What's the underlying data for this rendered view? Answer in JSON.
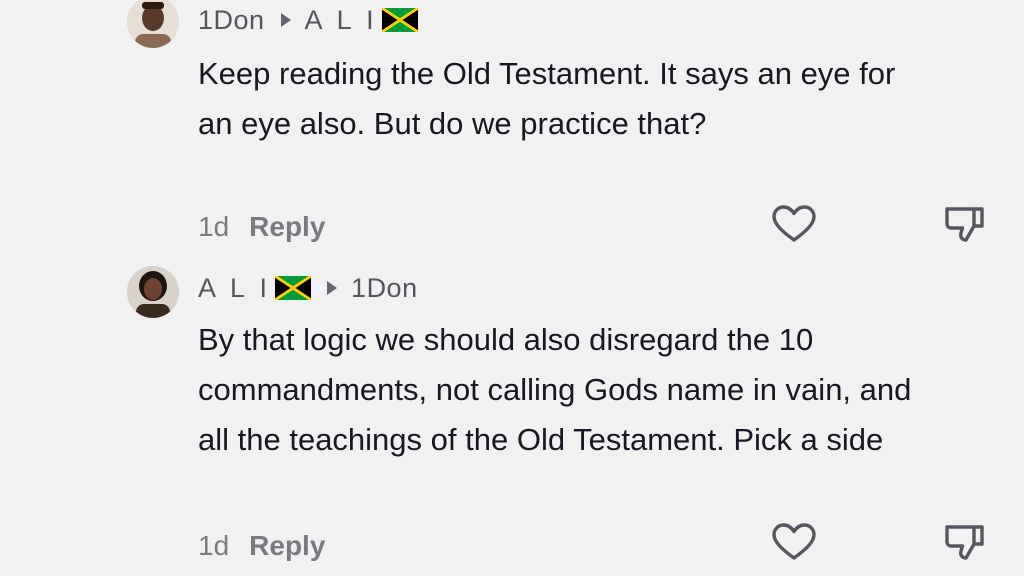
{
  "comments": [
    {
      "avatar_icon": "user-avatar-man",
      "username": "1Don",
      "reply_to": "A L I",
      "reply_to_flag": "jamaica-flag-icon",
      "text": "Keep reading the Old Testament. It says an eye for an eye also. But do we practice that?",
      "time": "1d",
      "reply_label": "Reply"
    },
    {
      "avatar_icon": "user-avatar-woman",
      "username": "A L I",
      "username_flag": "jamaica-flag-icon",
      "reply_to": "1Don",
      "text": "By that logic we should also disregard the 10 commandments, not calling Gods name in vain, and all the teachings of the Old Testament. Pick a side",
      "time": "1d",
      "reply_label": "Reply"
    }
  ],
  "colors": {
    "background": "#f1f1f1",
    "text_primary": "#161823",
    "text_secondary": "#7a7b82",
    "flag_green": "#009b3a",
    "flag_yellow": "#fed100",
    "flag_black": "#000000"
  }
}
